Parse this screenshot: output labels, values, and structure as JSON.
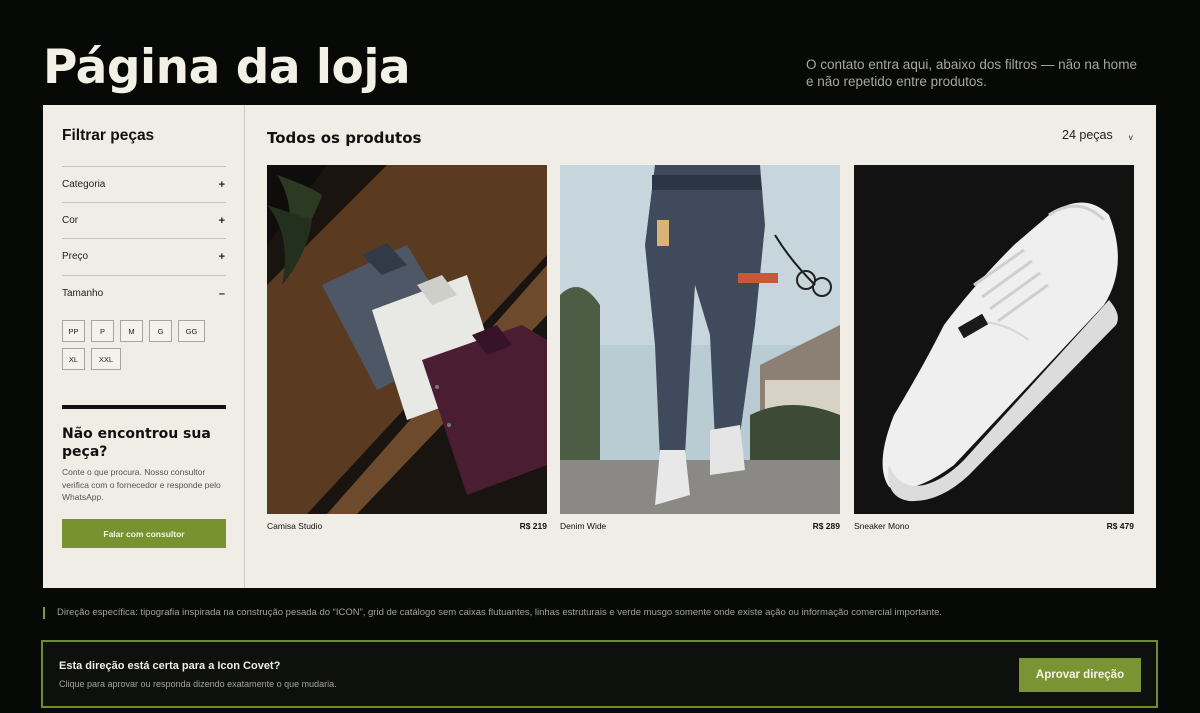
{
  "header": {
    "title": "Página da loja",
    "note": "O contato entra aqui, abaixo dos filtros — não na home e não repetido entre produtos."
  },
  "filters": {
    "title": "Filtrar peças",
    "groups": [
      {
        "label": "Categoria",
        "sign": "+"
      },
      {
        "label": "Cor",
        "sign": "+"
      },
      {
        "label": "Preço",
        "sign": "+"
      },
      {
        "label": "Tamanho",
        "sign": "–"
      }
    ],
    "sizes": [
      "PP",
      "P",
      "M",
      "G",
      "GG",
      "XL",
      "XXL"
    ]
  },
  "help": {
    "title": "Não encontrou sua peça?",
    "text": "Conte o que procura. Nosso consultor verifica com o fornecedor e responde pelo WhatsApp.",
    "cta": "Falar com consultor"
  },
  "catalog": {
    "title": "Todos os produtos",
    "count": "24 peças",
    "sort_icon": "chevron-down-icon",
    "products": [
      {
        "name": "Camisa Studio",
        "price": "R$ 219"
      },
      {
        "name": "Denim Wide",
        "price": "R$ 289"
      },
      {
        "name": "Sneaker Mono",
        "price": "R$ 479"
      }
    ]
  },
  "note": "Direção específica: tipografia inspirada na construção pesada do “ICON”, grid de catálogo sem caixas flutuantes, linhas estruturais e verde musgo somente onde existe ação ou informação comercial importante.",
  "approval": {
    "question": "Esta direção está certa para a Icon Covet?",
    "subtitle": "Clique para aprovar ou responda dizendo exatamente o que mudaria.",
    "button": "Aprovar direção"
  },
  "colors": {
    "background": "#070907",
    "panel": "#f0ede6",
    "accent": "#7b9433"
  }
}
